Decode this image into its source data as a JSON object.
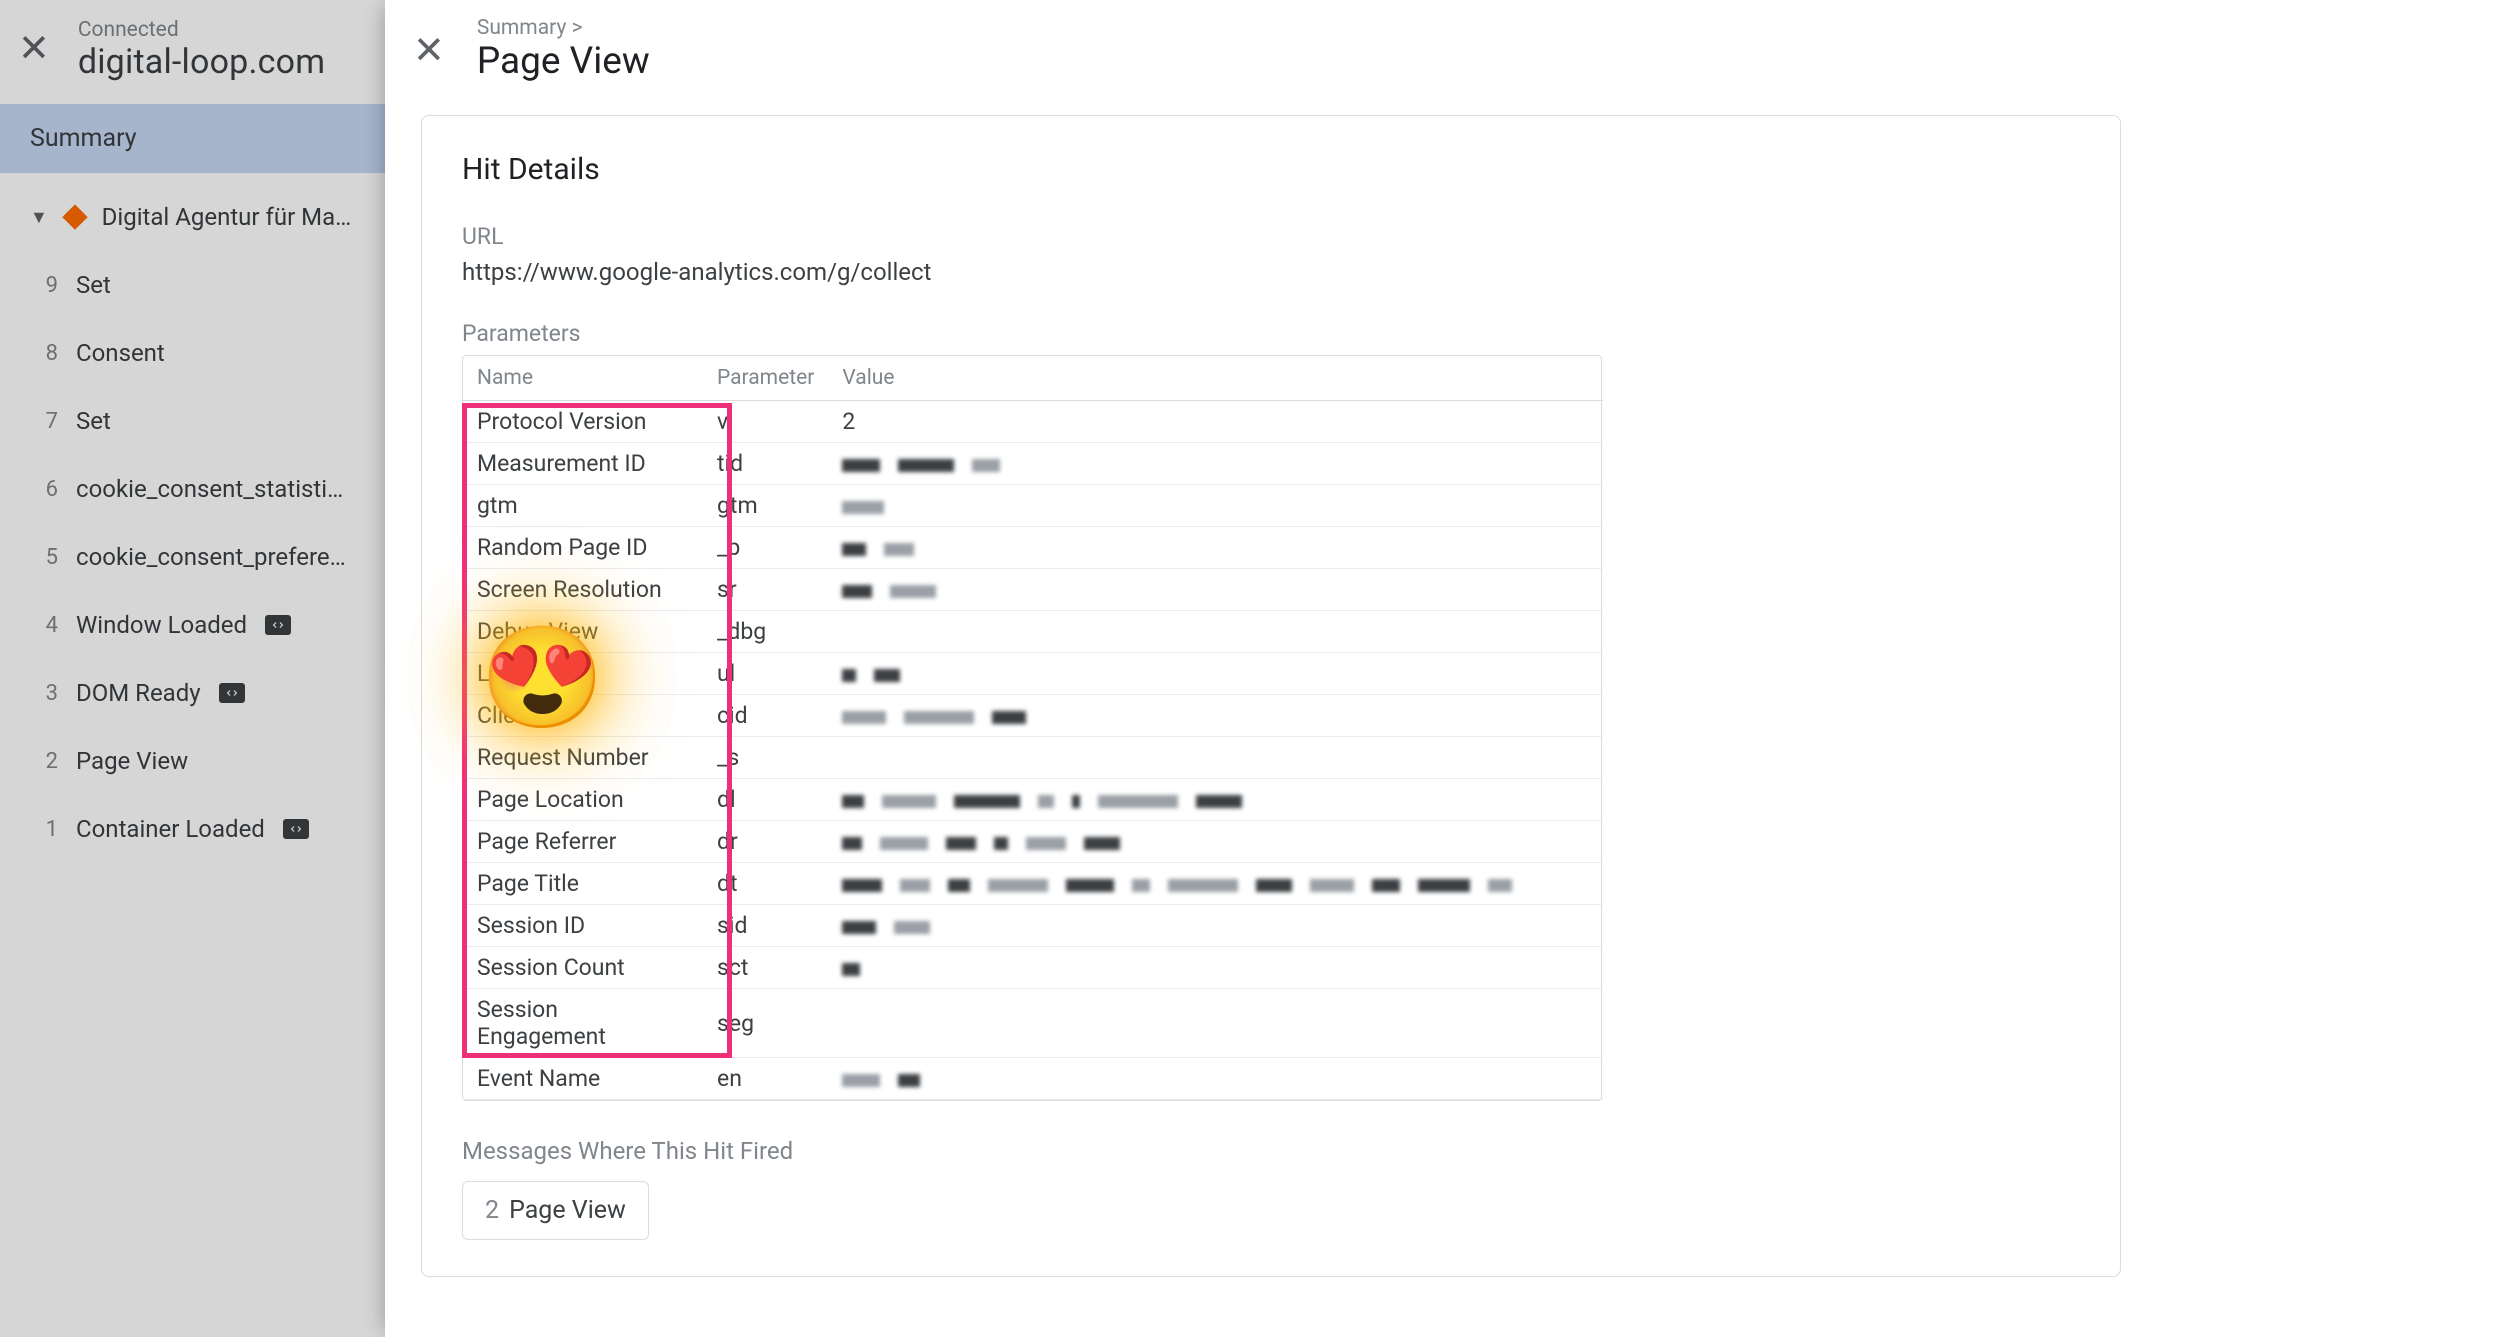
{
  "sidebar": {
    "connected_label": "Connected",
    "domain": "digital-loop.com",
    "summary_label": "Summary",
    "active_item": "Digital Agentur für Mar…",
    "items": [
      {
        "num": "9",
        "label": "Set",
        "tag": false
      },
      {
        "num": "8",
        "label": "Consent",
        "tag": false
      },
      {
        "num": "7",
        "label": "Set",
        "tag": false
      },
      {
        "num": "6",
        "label": "cookie_consent_statistics",
        "tag": false
      },
      {
        "num": "5",
        "label": "cookie_consent_prefere…",
        "tag": false
      },
      {
        "num": "4",
        "label": "Window Loaded",
        "tag": true
      },
      {
        "num": "3",
        "label": "DOM Ready",
        "tag": true
      },
      {
        "num": "2",
        "label": "Page View",
        "tag": false
      },
      {
        "num": "1",
        "label": "Container Loaded",
        "tag": true
      }
    ]
  },
  "main": {
    "breadcrumb": "Summary >",
    "title": "Page View",
    "card_title": "Hit Details",
    "url_label": "URL",
    "url_value": "https://www.google-analytics.com/g/collect",
    "params_label": "Parameters",
    "th_name": "Name",
    "th_param": "Parameter",
    "th_value": "Value",
    "rows": [
      {
        "name": "Protocol Version",
        "param": "v",
        "val": "2"
      },
      {
        "name": "Measurement ID",
        "param": "tid",
        "val": ""
      },
      {
        "name": "gtm",
        "param": "gtm",
        "val": ""
      },
      {
        "name": "Random Page ID",
        "param": "_p",
        "val": ""
      },
      {
        "name": "Screen Resolution",
        "param": "sr",
        "val": ""
      },
      {
        "name": "Debug View",
        "param": "_dbg",
        "val": ""
      },
      {
        "name": "Language",
        "param": "ul",
        "val": ""
      },
      {
        "name": "Client ID",
        "param": "cid",
        "val": ""
      },
      {
        "name": "Request Number",
        "param": "_s",
        "val": ""
      },
      {
        "name": "Page Location",
        "param": "dl",
        "val": ""
      },
      {
        "name": "Page Referrer",
        "param": "dr",
        "val": ""
      },
      {
        "name": "Page Title",
        "param": "dt",
        "val": ""
      },
      {
        "name": "Session ID",
        "param": "sid",
        "val": ""
      },
      {
        "name": "Session Count",
        "param": "sct",
        "val": ""
      },
      {
        "name": "Session Engagement",
        "param": "seg",
        "val": ""
      },
      {
        "name": "Event Name",
        "param": "en",
        "val": ""
      }
    ],
    "msg_label": "Messages Where This Hit Fired",
    "chip_num": "2",
    "chip_label": "Page View"
  },
  "emoji": "😍"
}
